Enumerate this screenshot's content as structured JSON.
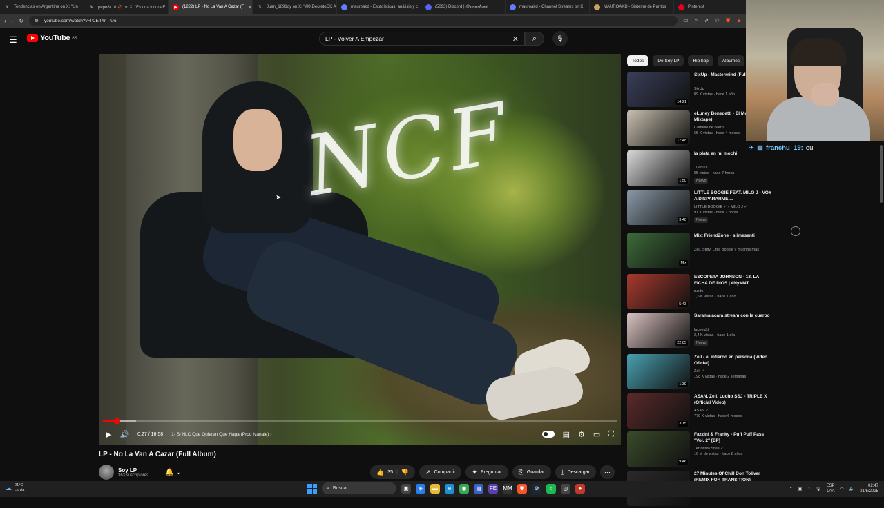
{
  "browser": {
    "tabs": [
      {
        "label": "Tendencias en Argentina on X: \"Un",
        "icon": "x-icon",
        "color": "#ffffff"
      },
      {
        "label": "pepe8x10 🥀 on X: \"Es una locura E",
        "icon": "x-icon",
        "color": "#ffffff"
      },
      {
        "label": "(1222) LP - No La Van A Cazar (F",
        "icon": "youtube-icon",
        "color": "#ff0000",
        "active": true
      },
      {
        "label": "Juan_1891oy on X: \"@XDecretoOK A",
        "icon": "x-icon",
        "color": "#ffffff"
      },
      {
        "label": "mauroakd - Estadísticas, análisis y c",
        "icon": "stats-icon",
        "color": "#5f7fff"
      },
      {
        "label": "(5093) Discord | @𝓈𝓂𝒶𝓇𝓉ℴ𝓈ℯ𝒹",
        "icon": "discord-icon",
        "color": "#5865f2"
      },
      {
        "label": "mauroakd - Channel Streams on K",
        "icon": "stats-icon",
        "color": "#5f7fff"
      },
      {
        "label": "MAUROAKD - Sistema de Puntos",
        "icon": "points-icon",
        "color": "#c9a35b"
      },
      {
        "label": "Pinterest",
        "icon": "pinterest-icon",
        "color": "#e60023"
      }
    ],
    "url": "youtube.com/watch?v=P2EIPIn_-Uo"
  },
  "youtube": {
    "logo_text": "YouTube",
    "country": "AR",
    "search_query": "LP - Volver A Empezar"
  },
  "player": {
    "overlay_text": "NCF",
    "time_current": "0:27",
    "time_total": "16:58",
    "time_display": "0:27 / 16:58",
    "chapter": "1- Si NLC Que Quieren Que Haga (Prod Ivanale) ›",
    "progress": 0.027,
    "buffered": 0.065
  },
  "video": {
    "title": "LP - No La Van A Cazar (Full Album)",
    "channel": "Soy LP",
    "subscribers": "363 suscriptores",
    "likes": "35",
    "share": "Compartir",
    "ask": "Preguntar",
    "save": "Guardar",
    "download": "Descargar"
  },
  "chips": [
    "Todos",
    "De Soy LP",
    "Hip hop",
    "Álbumes"
  ],
  "recommendations": [
    {
      "title": "SixUp - Mastermind (Full Mixtape)",
      "channel": "SixUp",
      "meta": "89 K vistas · hace 1 año",
      "duration": "14:21",
      "badge": "",
      "thumb": "#3a3f5a"
    },
    {
      "title": "eLuney Benedetti - El Moroon (Full Mixtape)",
      "channel": "Camello de Barro",
      "meta": "65 K vistas · hace 4 meses",
      "duration": "17:48",
      "badge": "",
      "thumb": "#c8c0b0"
    },
    {
      "title": "la plata en mi mochi",
      "channel": "Tueni2C",
      "meta": "85 vistas · hace 7 horas",
      "duration": "1:50",
      "badge": "Nuevo",
      "thumb": "#d9d9d9"
    },
    {
      "title": "LITTLE BOOGIE FEAT. MILO J - VOY A DISPARARME ...",
      "channel": "LITTLE BOOGIE ✓ y MILO J ✓",
      "meta": "91 K vistas · hace 7 horas",
      "duration": "3:40",
      "badge": "Nuevo",
      "thumb": "#8a9aa8"
    },
    {
      "title": "Mix: FriendZone - slimesanti",
      "channel": "Zell, Stiffy, Little Boogie y muchos más",
      "meta": "",
      "duration": "Mix",
      "badge": "",
      "thumb": "#3d6b3a"
    },
    {
      "title": "ESCOPETA JOHNSON - 13. LA FICHA DE DIOS | #NyMNT",
      "channel": "rusito",
      "meta": "1,6 K vistas · hace 1 año",
      "duration": "5:43",
      "badge": "",
      "thumb": "#a83a2e"
    },
    {
      "title": "Saramalacara stream con la cuerpo",
      "channel": "faceeidd",
      "meta": "2,4 K vistas · hace 1 día",
      "duration": "22:05",
      "badge": "Nuevo",
      "thumb": "#d9c2c0"
    },
    {
      "title": "Zell - el infierno en persona (Video Oficial)",
      "channel": "Zell ✓",
      "meta": "198 K vistas · hace 2 semanas",
      "duration": "1:39",
      "badge": "",
      "thumb": "#4aa0b0"
    },
    {
      "title": "ASAN, Zell, Lucho SSJ - TRIPLE X (Official Video)",
      "channel": "ASAN ✓",
      "meta": "779 K vistas · hace 6 meses",
      "duration": "3:15",
      "badge": "",
      "thumb": "#5a2a2a"
    },
    {
      "title": "Fazzini & Franky - Puff Puff Pass \"Vol. 2\" [EP]",
      "channel": "Terrorista Style ✓",
      "meta": "16 M de vistas · hace 8 años",
      "duration": "9:46",
      "badge": "",
      "thumb": "#3a4a2a"
    },
    {
      "title": "27 Minutes Of Chill Don Toliver (REMIX FOR TRANSITION)",
      "channel": "",
      "meta": "",
      "duration": "",
      "badge": "",
      "thumb": "#2a2a2a"
    }
  ],
  "stream": {
    "chat_user": "franchu_19:",
    "chat_message": "eu"
  },
  "taskbar": {
    "temp": "21°C",
    "weather": "Lluvia",
    "search": "Buscar",
    "lang": "ESP",
    "lang2": "LAA",
    "time": "02:47",
    "date": "21/5/2025"
  }
}
